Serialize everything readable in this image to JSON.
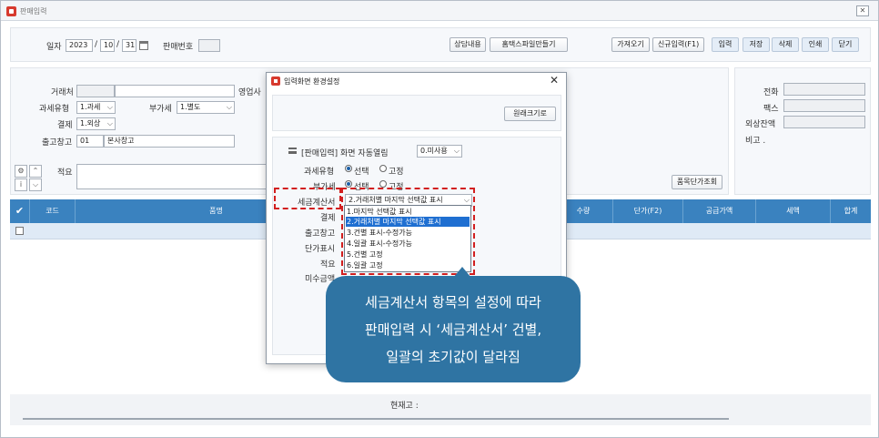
{
  "window": {
    "title": "판매입력"
  },
  "header": {
    "date_label": "일자",
    "year": "2023",
    "month": "10",
    "day": "31",
    "sale_no_label": "판매번호",
    "buttons": [
      "상담내용",
      "홈택스파일만들기",
      "가져오기",
      "신규입력(F1)",
      "입력",
      "저장",
      "삭제",
      "인쇄",
      "닫기"
    ]
  },
  "form": {
    "customer_label": "거래처",
    "sales_rep_label": "영업사",
    "tax_type_label": "과세유형",
    "tax_type_value": "1.과세",
    "vat_label": "부가세",
    "vat_value": "1.별도",
    "settle_label": "결제",
    "settle_value": "1.외상",
    "warehouse_label": "출고창고",
    "warehouse_code": "01",
    "warehouse_name": "본사창고",
    "memo_label": "적요",
    "item_price_btn": "품목단가조회",
    "phone_label": "전화",
    "fax_label": "팩스",
    "balance_label": "외상잔액",
    "note_label": "비고 ."
  },
  "grid": {
    "columns": [
      "코드",
      "품명",
      "수량",
      "단가(F2)",
      "공급가액",
      "세액",
      "합계"
    ]
  },
  "footer": {
    "stock_label": "현재고 :"
  },
  "dialog": {
    "title": "입력화면 환경설정",
    "restore_btn": "원래크기로",
    "auto_open_label": "[판매입력] 화면 자동열림",
    "auto_open_value": "0.미사용",
    "tax_type_label": "과세유형",
    "vat_label": "부가세",
    "radio_select": "선택",
    "radio_fixed": "고정",
    "invoice_label": "세금계산서",
    "invoice_value": "2.거래처별 마지막 선택값 표시",
    "rows_left": [
      "결제",
      "출고창고",
      "단가표시",
      "적요",
      "미수금액"
    ],
    "dropdown_options": [
      "1.마지막 선택값 표시",
      "2.거래처별 마지막 선택값 표시",
      "3.건별 표시-수정가능",
      "4.일괄 표시-수정가능",
      "5.건별 고정",
      "6.일괄 고정"
    ]
  },
  "callout": {
    "lines": [
      "세금계산서 항목의 설정에 따라",
      "판매입력 시 ‘세금계산서’ 건별,",
      "일괄의 초기값이 달라짐"
    ]
  },
  "colors": {
    "grid_header": "#3a82bf",
    "callout": "#2f74a3",
    "highlight": "#d21f1f",
    "selected_option": "#1f6fd1"
  }
}
